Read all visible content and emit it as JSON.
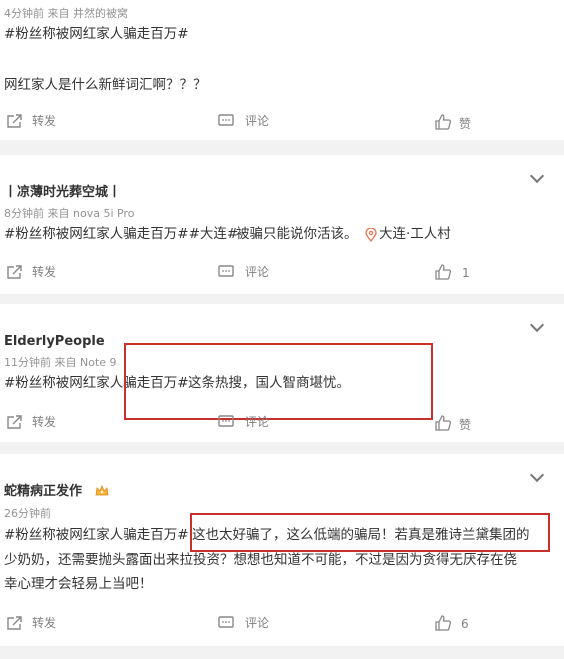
{
  "posts": [
    {
      "meta": "4分钟前  来自 井然的被窝",
      "hashtag": "#粉丝称被网红家人骗走百万#",
      "body": "网红家人是什么新鲜词汇啊？？？",
      "actions": {
        "repost": "转发",
        "comment": "评论",
        "like": "赞"
      }
    },
    {
      "name": "丨凉薄时光葬空城丨",
      "meta": "8分钟前  来自 nova 5i Pro",
      "hashtag": "#粉丝称被网红家人骗走百万##大连#",
      "body": "被骗只能说你活该。",
      "location": "大连·工人村",
      "actions": {
        "repost": "转发",
        "comment": "评论",
        "like": "1"
      }
    },
    {
      "name": "ElderlyPeople",
      "meta": "11分钟前  来自 Note 9",
      "hashtag": "#粉丝称被网红家人骗走百万#",
      "body": "这条热搜，国人智商堪忧。",
      "actions": {
        "repost": "转发",
        "comment": "评论",
        "like": "赞"
      }
    },
    {
      "name": "蛇精病正发作",
      "meta": "26分钟前",
      "hashtag": "#粉丝称被网红家人骗走百万#",
      "body_line1": "这也太好骗了，这么低端的骗局！若真是雅诗兰黛集团的",
      "body_line2": "少奶奶，还需要抛头露面出来拉投资？想想也知道不可能，不过是因为贪得无厌存在侥",
      "body_line3": "幸心理才会轻易上当吧！",
      "actions": {
        "repost": "转发",
        "comment": "评论",
        "like": "6"
      }
    }
  ],
  "icons": {
    "repost": "repost-icon",
    "comment": "comment-icon",
    "like": "thumbs-up-icon",
    "expand": "chevron-down-icon",
    "location": "location-pin-icon",
    "badge": "member-badge-icon"
  },
  "colors": {
    "accent": "#eb7350",
    "highlight_box": "#c9302c"
  }
}
